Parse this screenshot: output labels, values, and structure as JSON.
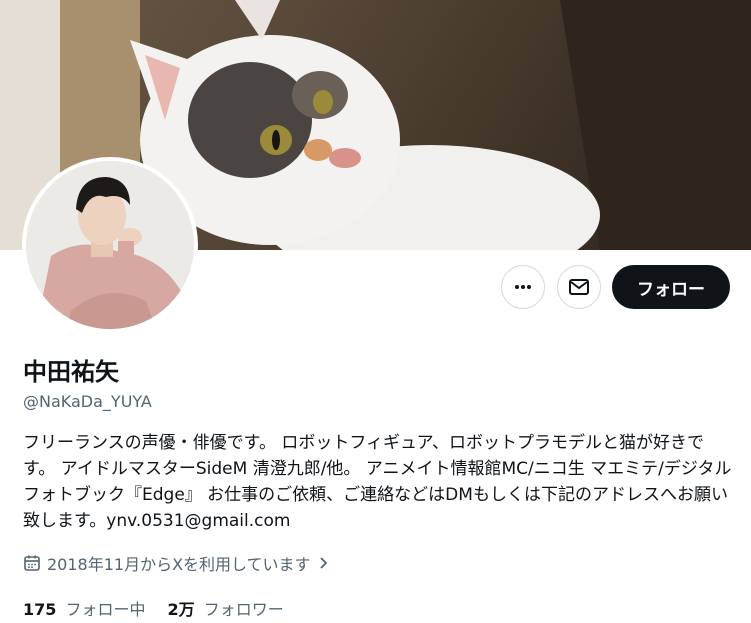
{
  "banner": {
    "alt": "cat photo banner"
  },
  "avatar": {
    "alt": "profile photo"
  },
  "actions": {
    "more_icon": "more-horizontal-icon",
    "message_icon": "envelope-icon",
    "follow_label": "フォロー"
  },
  "profile": {
    "name": "中田祐矢",
    "handle": "@NaKaDa_YUYA",
    "bio": "フリーランスの声優・俳優です。 ロボットフィギュア、ロボットプラモデルと猫が好きです。 アイドルマスターSideM 清澄九郎/他。 アニメイト情報館MC/ニコ生 マエミテ/デジタルフォトブック『Edge』 お仕事のご依頼、ご連絡などはDMもしくは下記のアドレスへお願い致します。ynv.0531@gmail.com",
    "joined": "2018年11月からXを利用しています",
    "joined_icon": "calendar-icon"
  },
  "stats": {
    "following_count": "175",
    "following_label": "フォロー中",
    "followers_count": "2万",
    "followers_label": "フォロワー"
  },
  "colors": {
    "primary_text": "#0f1419",
    "secondary_text": "#536471",
    "border": "#cfd9de",
    "follow_bg": "#0f1419"
  }
}
